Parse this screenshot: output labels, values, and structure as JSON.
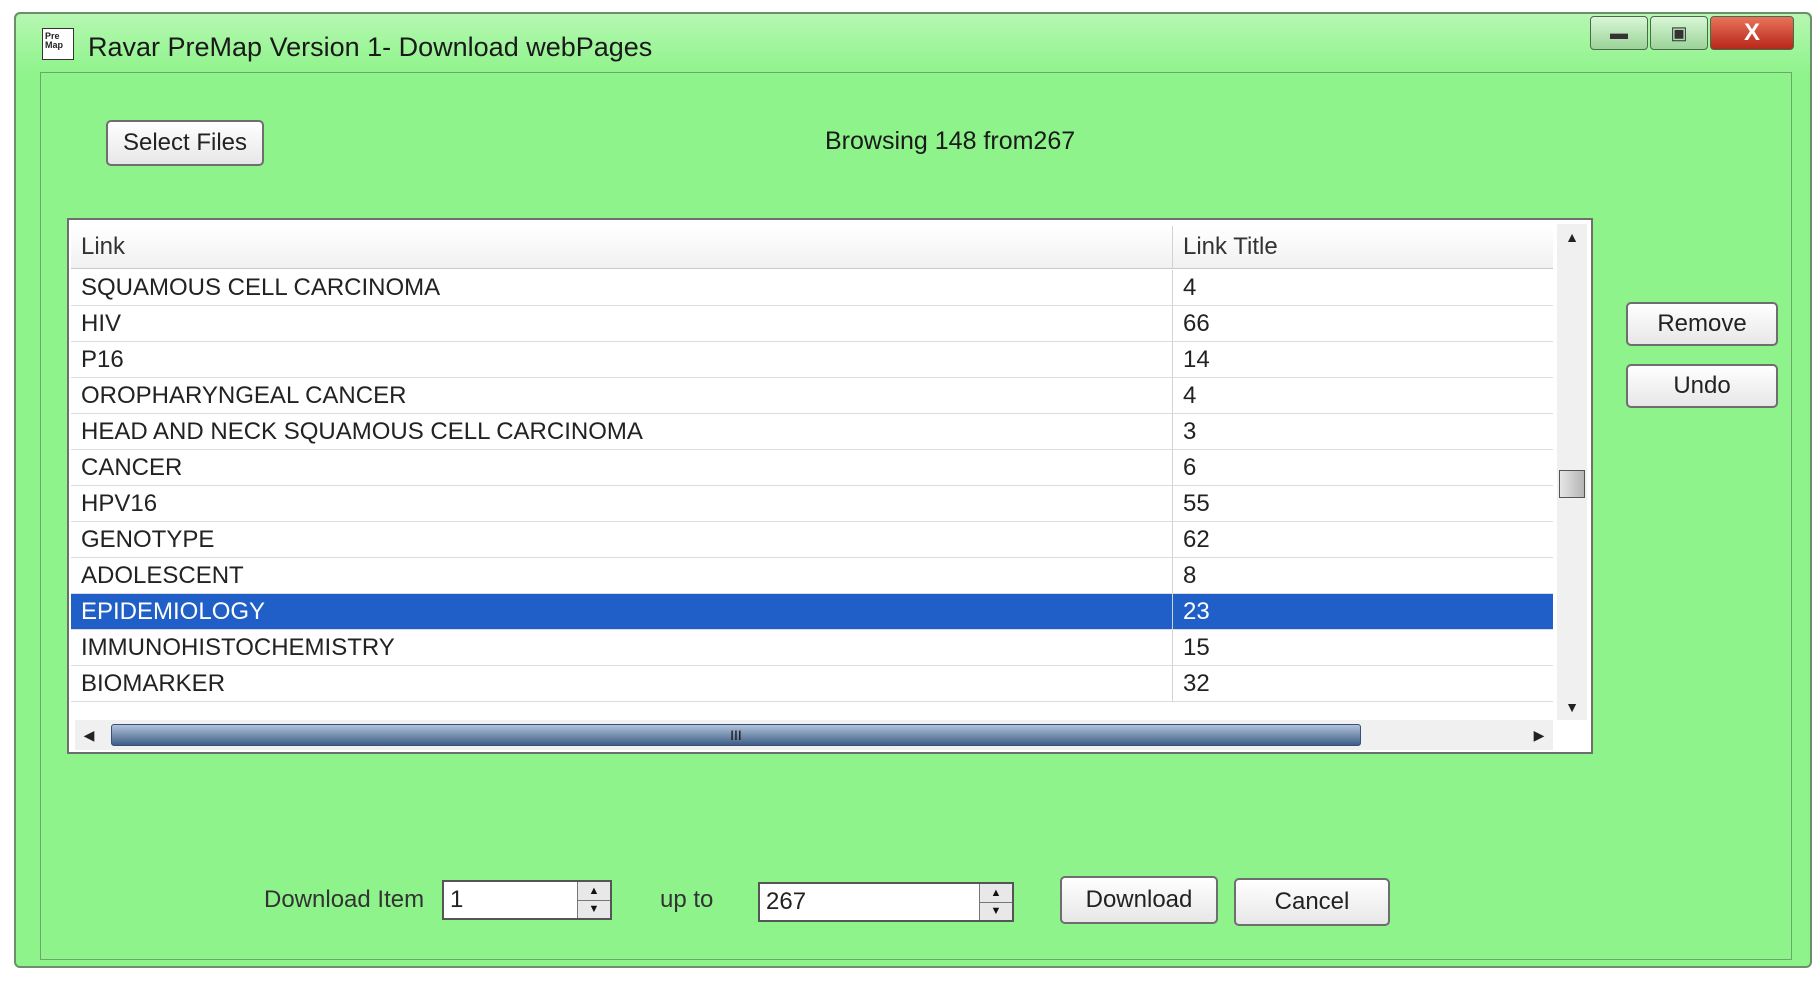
{
  "window": {
    "title": "Ravar PreMap Version 1- Download webPages",
    "icon_text": "Pre Map",
    "minimize_icon": "minimize-icon",
    "maximize_icon": "maximize-icon",
    "close_icon": "close-icon",
    "close_label": "X",
    "background_color": "#8ef38a"
  },
  "toolbar": {
    "select_files_label": "Select Files",
    "status_text": "Browsing 148 from267"
  },
  "list": {
    "columns": [
      "Link",
      "Link Title"
    ],
    "rows": [
      {
        "link": "SQUAMOUS CELL CARCINOMA",
        "title": "4"
      },
      {
        "link": "HIV",
        "title": "66"
      },
      {
        "link": "P16",
        "title": "14"
      },
      {
        "link": "OROPHARYNGEAL CANCER",
        "title": "4"
      },
      {
        "link": "HEAD AND NECK SQUAMOUS CELL CARCINOMA",
        "title": "3"
      },
      {
        "link": "CANCER",
        "title": "6"
      },
      {
        "link": "HPV16",
        "title": "55"
      },
      {
        "link": "GENOTYPE",
        "title": "62"
      },
      {
        "link": "ADOLESCENT",
        "title": "8"
      },
      {
        "link": "EPIDEMIOLOGY",
        "title": "23"
      },
      {
        "link": "IMMUNOHISTOCHEMISTRY",
        "title": "15"
      },
      {
        "link": "BIOMARKER",
        "title": "32"
      }
    ],
    "selected_index": 9,
    "selected_color": "#1f5fc7",
    "hscroll_grip": "III"
  },
  "side_buttons": {
    "remove_label": "Remove",
    "undo_label": "Undo"
  },
  "footer": {
    "download_item_label": "Download Item",
    "from_value": "1",
    "up_to_label": "up to",
    "to_value": "267",
    "download_label": "Download",
    "cancel_label": "Cancel"
  }
}
